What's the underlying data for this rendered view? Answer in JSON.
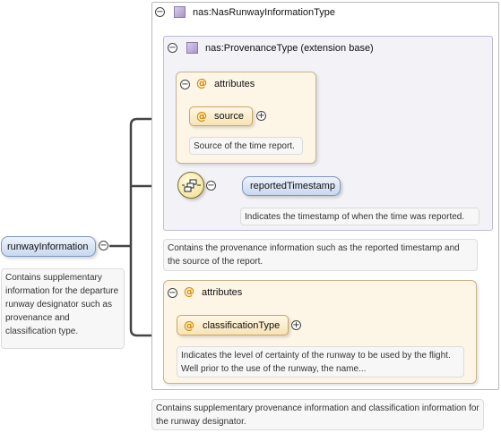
{
  "root_element": {
    "name": "runwayInformation",
    "description": "Contains supplementary information for the departure runway designator such as provenance and classification type."
  },
  "complex_type": {
    "name": "nas:NasRunwayInformationType",
    "description": "Contains supplementary provenance information and classification information for the runway designator."
  },
  "extension": {
    "name": "nas:ProvenanceType (extension base)",
    "attributes_label": "attributes",
    "attribute": {
      "name": "source",
      "description": "Source of the time report."
    },
    "child_element": {
      "name": "reportedTimestamp",
      "description": "Indicates the timestamp of when the time was reported."
    },
    "description": "Contains the provenance information such as the reported timestamp and the source of the report."
  },
  "attributes_group": {
    "label": "attributes",
    "attribute": {
      "name": "classificationType",
      "description": "Indicates the level of certainty of the runway to be used by the flight. Well prior to the use of the runway, the name..."
    }
  },
  "colors": {
    "element_fill": "#c9d8ef",
    "attribute_fill": "#f7e3b5",
    "attribute_group_bg": "#fdf5e6",
    "extension_bg": "#f2f2f7"
  }
}
